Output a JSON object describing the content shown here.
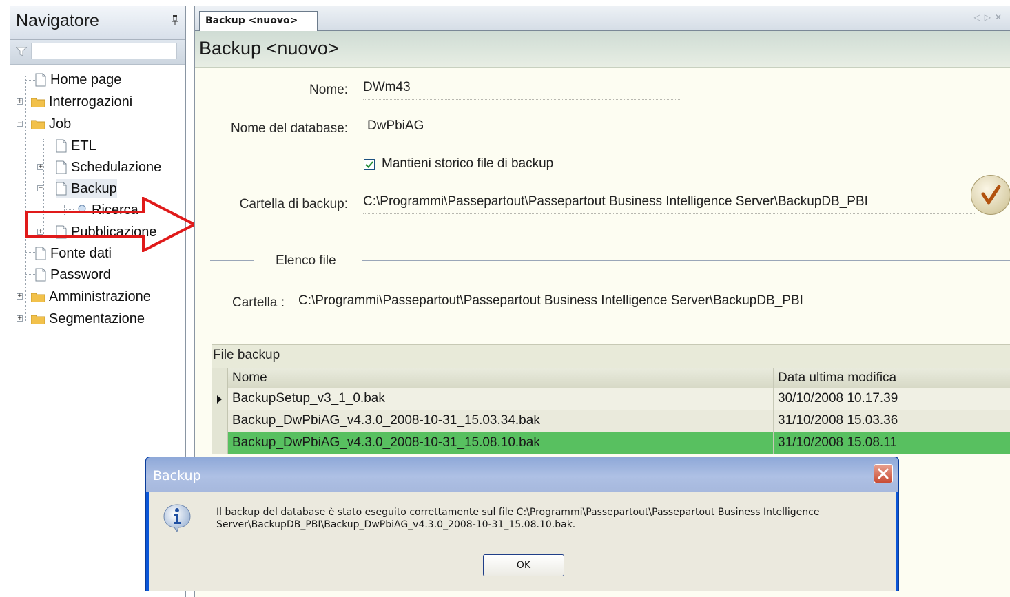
{
  "navigator": {
    "title": "Navigatore",
    "filter_value": "",
    "items": [
      {
        "label": "Home page",
        "icon": "doc-icon"
      },
      {
        "label": "Interrogazioni",
        "icon": "folder-icon"
      },
      {
        "label": "Job",
        "icon": "folder-icon"
      },
      {
        "label": "ETL",
        "icon": "doc-icon"
      },
      {
        "label": "Schedulazione",
        "icon": "doc-icon"
      },
      {
        "label": "Backup",
        "icon": "doc-icon"
      },
      {
        "label": "Ricerca",
        "icon": "search-icon"
      },
      {
        "label": "Pubblicazione",
        "icon": "doc-icon"
      },
      {
        "label": "Fonte dati",
        "icon": "doc-icon"
      },
      {
        "label": "Password",
        "icon": "doc-icon"
      },
      {
        "label": "Amministrazione",
        "icon": "folder-icon"
      },
      {
        "label": "Segmentazione",
        "icon": "folder-icon"
      }
    ]
  },
  "tab": {
    "label": "Backup <nuovo>"
  },
  "page": {
    "title": "Backup <nuovo>",
    "nome_label": "Nome:",
    "nome_value": "DWm43",
    "db_label": "Nome del database:",
    "db_value": "DwPbiAG",
    "keep_history_label": "Mantieni storico file di backup",
    "keep_history_checked": true,
    "folder_label": "Cartella di backup:",
    "folder_value": "C:\\Programmi\\Passepartout\\Passepartout  Business  Intelligence  Server\\BackupDB_PBI"
  },
  "file_list": {
    "section_title": "Elenco file",
    "folder_label": "Cartella :",
    "folder_value": "C:\\Programmi\\Passepartout\\Passepartout  Business  Intelligence  Server\\BackupDB_PBI",
    "grid_caption": "File backup",
    "columns": [
      "Nome",
      "Data ultima modifica"
    ],
    "rows": [
      {
        "name": "BackupSetup_v3_1_0.bak",
        "date": "30/10/2008 10.17.39"
      },
      {
        "name": "Backup_DwPbiAG_v4.3.0_2008-10-31_15.03.34.bak",
        "date": "31/10/2008 15.03.36"
      },
      {
        "name": "Backup_DwPbiAG_v4.3.0_2008-10-31_15.08.10.bak",
        "date": "31/10/2008 15.08.11"
      }
    ],
    "current_row": 0,
    "selected_row": 2,
    "selected_color": "#58c060"
  },
  "dialog": {
    "title": "Backup",
    "message_line1": "Il backup del database è stato eseguito correttamente sul file C:\\Programmi\\Passepartout\\Passepartout Business Intelligence",
    "message_line2": "Server\\BackupDB_PBI\\Backup_DwPbiAG_v4.3.0_2008-10-31_15.08.10.bak.",
    "ok_label": "OK"
  },
  "colors": {
    "accent_dialog": "#0b56d8",
    "annotation_arrow": "#e01a1a"
  }
}
